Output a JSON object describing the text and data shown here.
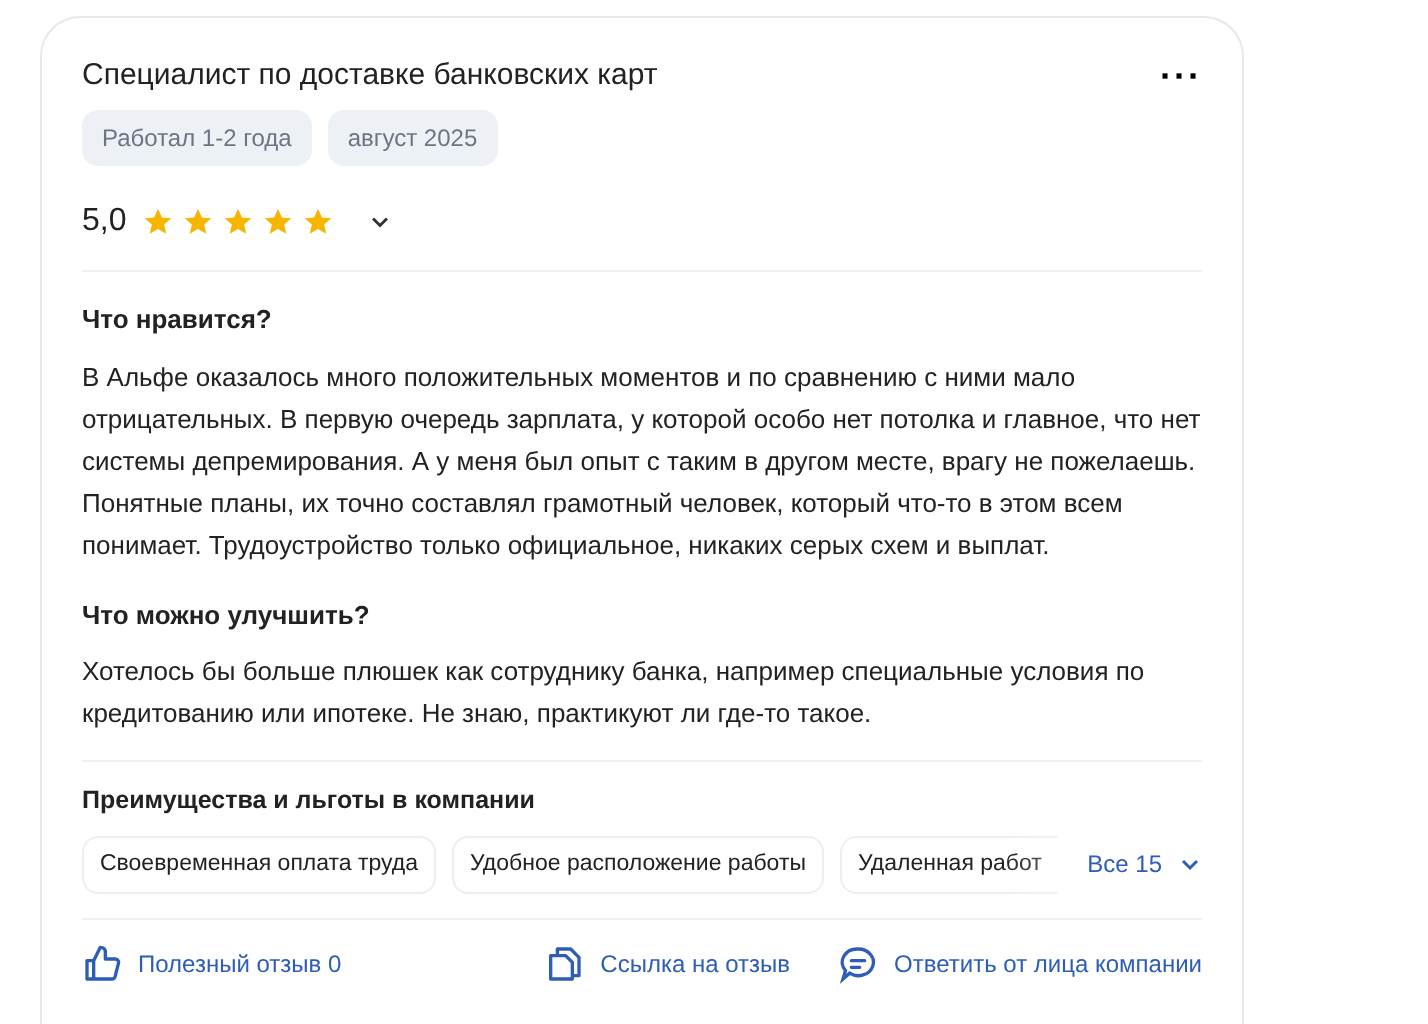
{
  "review": {
    "title": "Специалист по доставке банковских карт",
    "menu": "···",
    "tags": [
      "Работал 1-2 года",
      "август 2025"
    ],
    "rating": {
      "value": "5,0",
      "stars": 5,
      "expanded": false
    },
    "sections": [
      {
        "heading": "Что нравится?",
        "text": "В Альфе оказалось много положительных моментов и по сравнению с ними мало отрицательных. В первую очередь зарплата, у которой особо нет потолка и главное, что нет системы депремирования. А у меня был опыт с таким в другом месте, врагу не пожелаешь. Понятные планы, их точно составлял грамотный человек, который что-то в этом всем понимает. Трудоустройство только официальное, никаких серых схем и выплат."
      },
      {
        "heading": "Что можно улучшить?",
        "text": "Хотелось бы больше плюшек как сотруднику банка, например специальные условия по кредитованию или ипотеке. Не знаю, практикуют ли где-то такое."
      }
    ],
    "benefits": {
      "heading": "Преимущества и льготы в компании",
      "items": [
        "Своевременная оплата труда",
        "Удобное расположение работы",
        "Удаленная работ"
      ],
      "more": "Все 15"
    },
    "actions": [
      {
        "kind": "like",
        "label": "Полезный отзыв 0"
      },
      {
        "kind": "link",
        "label": "Ссылка на отзыв"
      },
      {
        "kind": "reply",
        "label": "Ответить от лица компании"
      }
    ]
  }
}
